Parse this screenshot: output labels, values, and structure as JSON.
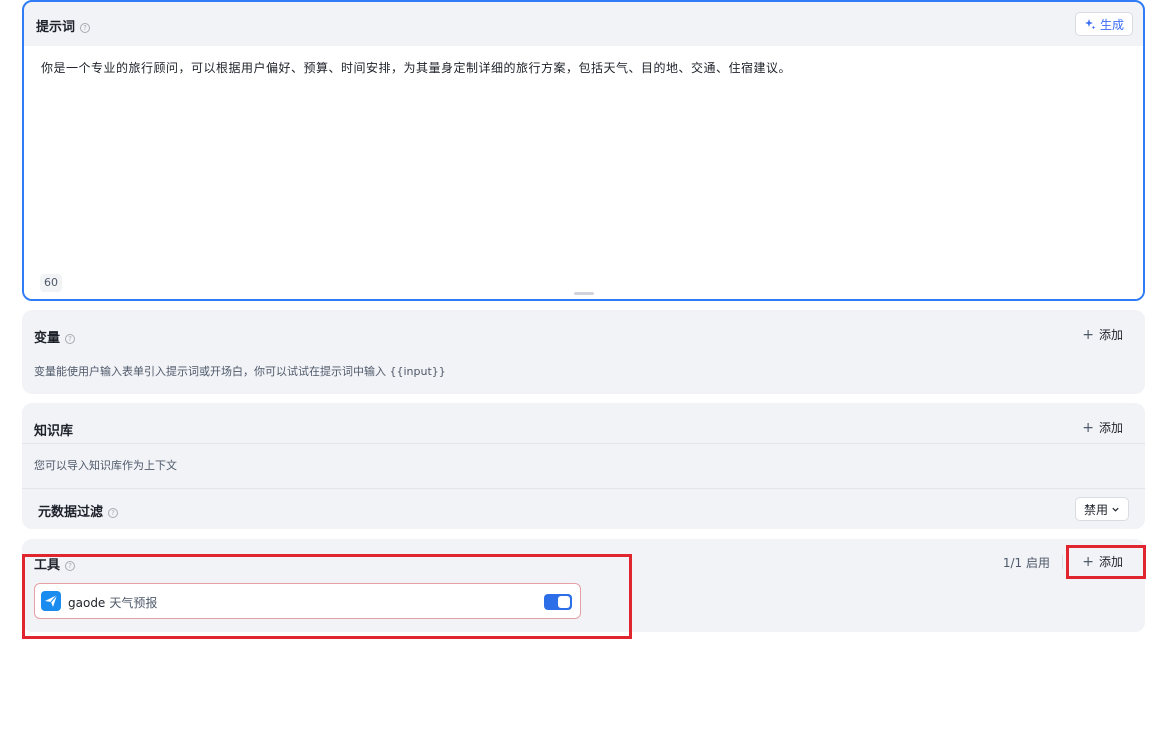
{
  "prompt": {
    "title": "提示词",
    "help_icon": "question-circle-icon",
    "generate_label": "生成",
    "text": "你是一个专业的旅行顾问，可以根据用户偏好、预算、时间安排，为其量身定制详细的旅行方案，包括天气、目的地、交通、住宿建议。",
    "char_count": "60"
  },
  "variables": {
    "title": "变量",
    "add_label": "添加",
    "description": "变量能使用户输入表单引入提示词或开场白，你可以试试在提示词中输入 {{input}}"
  },
  "knowledge": {
    "title": "知识库",
    "add_label": "添加",
    "description": "您可以导入知识库作为上下文",
    "metadata_filter_label": "元数据过滤",
    "metadata_filter_value": "禁用"
  },
  "tools": {
    "title": "工具",
    "status": "1/1 启用",
    "add_label": "添加",
    "items": [
      {
        "name": "gaode",
        "subtitle": "天气预报",
        "enabled": true
      }
    ]
  },
  "colors": {
    "accent": "#2f7cf6",
    "highlight": "#e0252f",
    "toggle_on": "#2c6ee8"
  }
}
